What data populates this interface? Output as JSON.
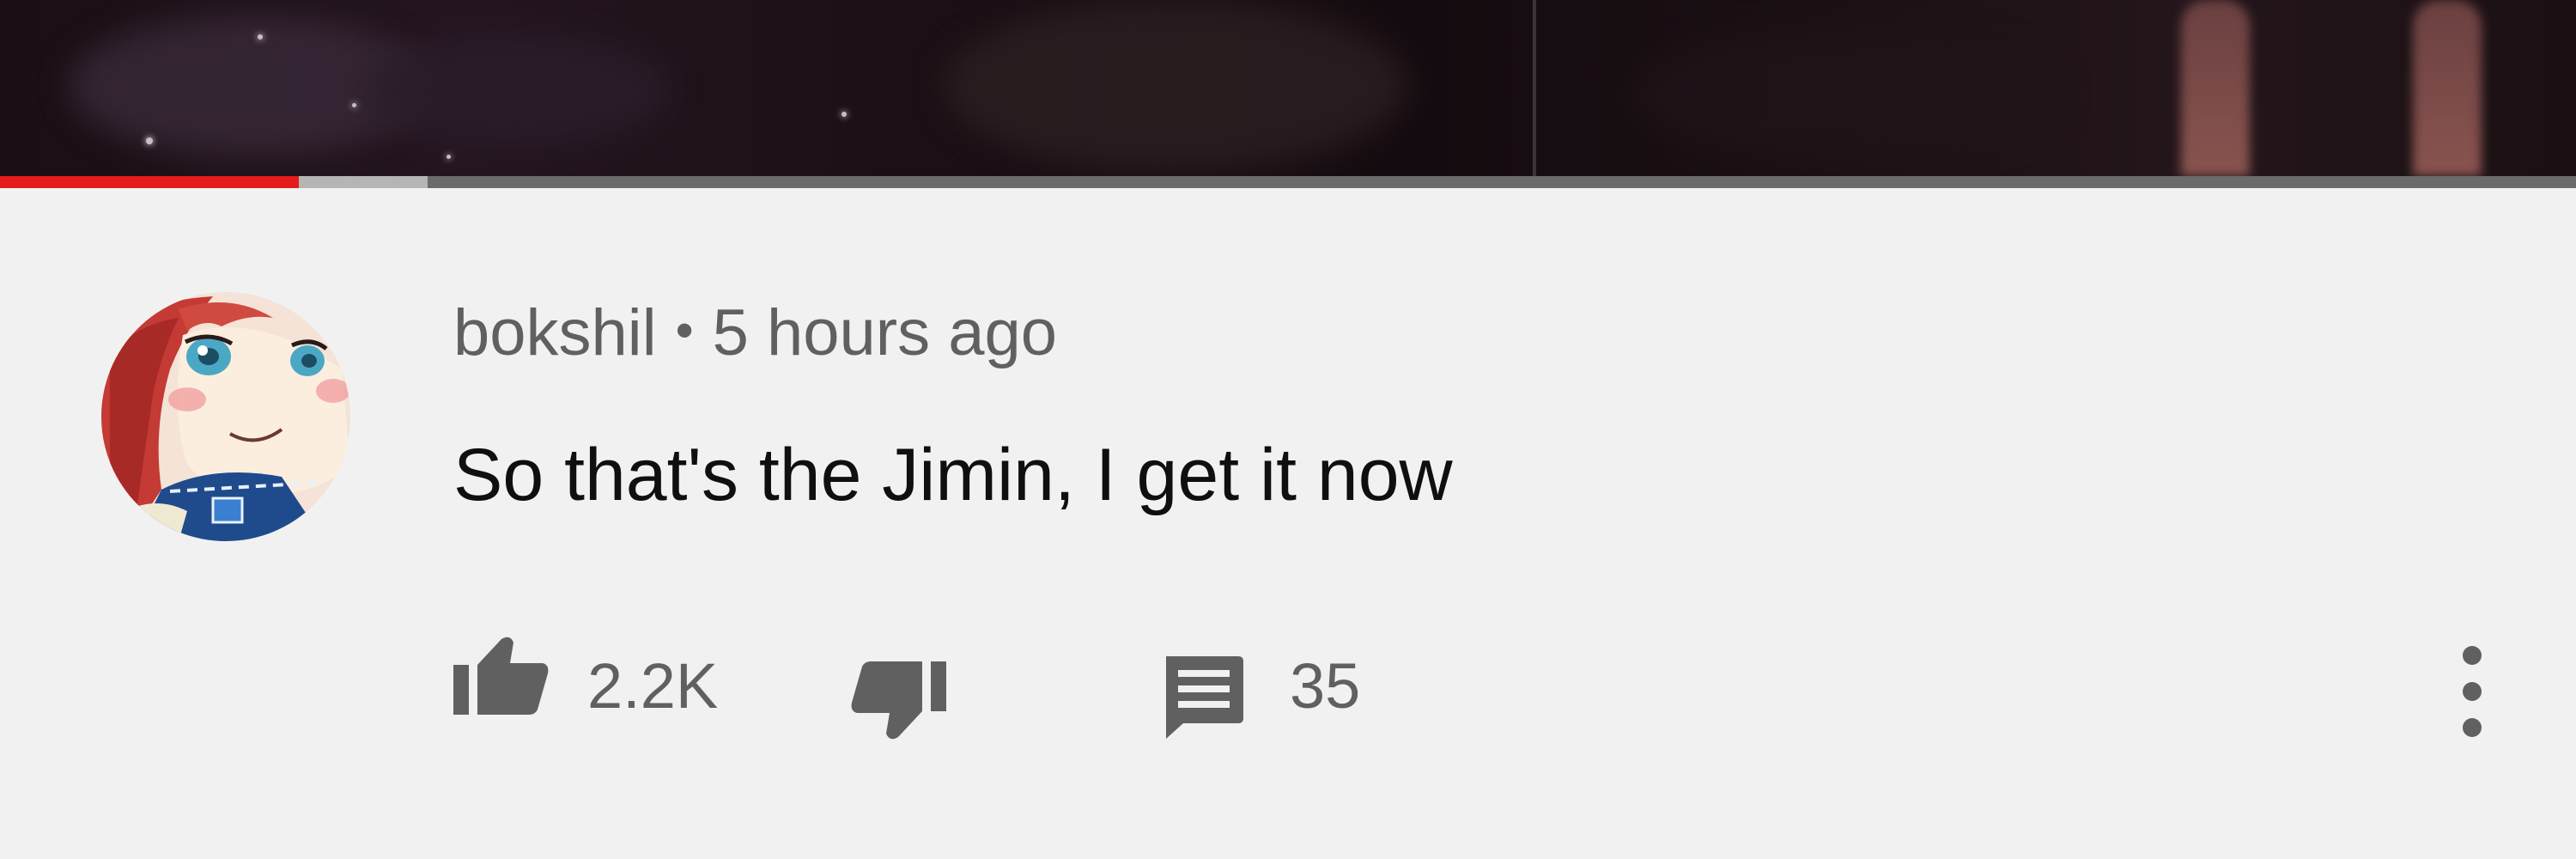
{
  "video": {
    "progress_fraction": 0.116,
    "buffer_fraction": 0.05,
    "colors": {
      "played": "#e51b1b",
      "buffered": "#b5b5b5",
      "track": "#6b6b6b"
    }
  },
  "comment": {
    "author": "bokshil",
    "separator": "•",
    "time": "5 hours ago",
    "text": "So that's the Jimin, I get it now",
    "avatar_icon": "anime-avatar"
  },
  "actions": {
    "like_icon": "thumbs-up-icon",
    "like_count": "2.2K",
    "dislike_icon": "thumbs-down-icon",
    "reply_icon": "comment-icon",
    "reply_count": "35",
    "more_icon": "more-vertical-icon"
  }
}
